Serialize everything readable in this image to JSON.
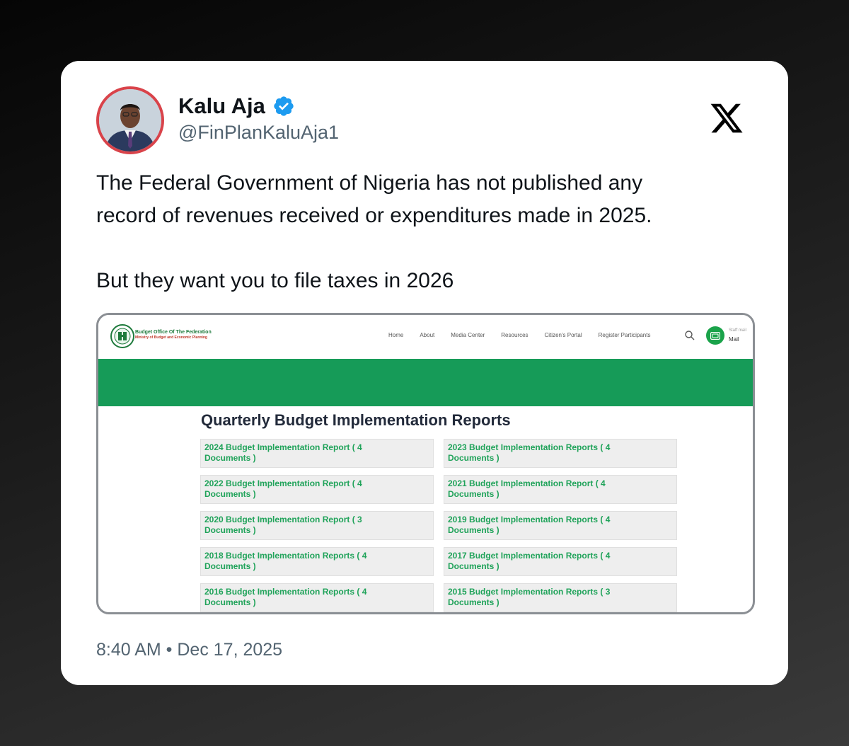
{
  "tweet": {
    "author_name": "Kalu Aja",
    "handle": "@FinPlanKaluAja1",
    "text_line1": "The Federal Government of Nigeria has not published any",
    "text_line2": "record of revenues received or expenditures made in 2025.",
    "text_line3": "But they want you to file taxes in 2026",
    "timestamp": "8:40 AM • Dec 17, 2025",
    "icons": {
      "verified": "verified-badge-icon",
      "platform": "x-logo-icon",
      "avatar": "avatar"
    },
    "colors": {
      "verified_blue": "#1d9bf0",
      "avatar_ring": "#d9434a",
      "text": "#0f1419",
      "muted": "#536471"
    }
  },
  "embedded_screenshot": {
    "site": {
      "brand_line1": "Budget Office Of The Federation",
      "brand_line2": "Ministry of Budget and Economic Planning",
      "nav": [
        "Home",
        "About",
        "Media Center",
        "Resources",
        "Citizen's Portal",
        "Register Participants"
      ],
      "staff_mail_small": "Staff mail",
      "mail_label": "Mail",
      "brand_green": "#169b58",
      "link_green": "#20a35a"
    },
    "section_title": "Quarterly Budget Implementation Reports",
    "reports": [
      {
        "line1": "2024 Budget Implementation Report ( 4",
        "line2": "Documents )"
      },
      {
        "line1": "2023 Budget Implementation Reports ( 4",
        "line2": "Documents )"
      },
      {
        "line1": "2022 Budget Implementation Report ( 4",
        "line2": "Documents )"
      },
      {
        "line1": "2021 Budget Implementation Report ( 4",
        "line2": "Documents )"
      },
      {
        "line1": "2020 Budget Implementation Report ( 3",
        "line2": "Documents )"
      },
      {
        "line1": "2019 Budget Implementation Reports ( 4",
        "line2": "Documents )"
      },
      {
        "line1": "2018 Budget Implementation Reports ( 4",
        "line2": "Documents )"
      },
      {
        "line1": "2017 Budget Implementation Reports ( 4",
        "line2": "Documents )"
      },
      {
        "line1": "2016 Budget Implementation Reports ( 4",
        "line2": "Documents )"
      },
      {
        "line1": "2015 Budget Implementation Reports ( 3",
        "line2": "Documents )"
      }
    ]
  }
}
